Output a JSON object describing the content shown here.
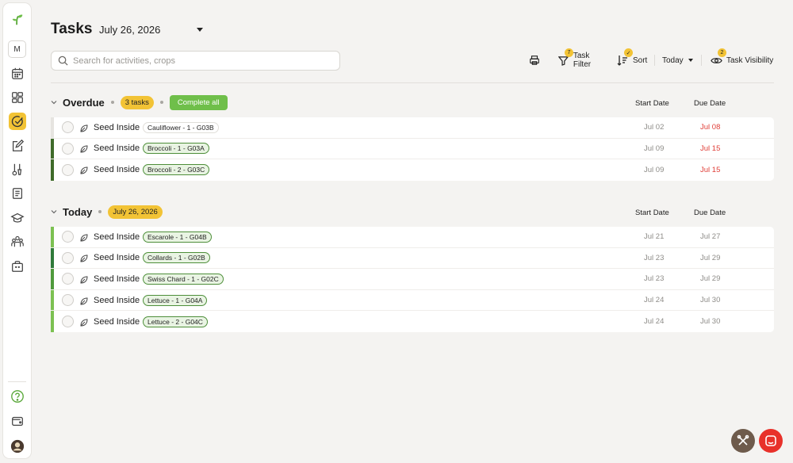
{
  "header": {
    "title": "Tasks",
    "date": "July 26, 2026"
  },
  "search": {
    "placeholder": "Search for activities, crops"
  },
  "toolbar": {
    "print_icon": "printer-icon",
    "task_filter_label": "Task Filter",
    "task_filter_count": "7",
    "sort_label": "Sort",
    "sort_badge": "✓",
    "today_label": "Today",
    "task_visibility_label": "Task Visibility",
    "task_visibility_count": "2"
  },
  "sidebar": {
    "profile_initial": "M",
    "icons": [
      "logo-sprout-icon",
      "calendar-icon",
      "dashboard-icon",
      "tasks-icon",
      "edit-icon",
      "tools-icon",
      "notes-icon",
      "learning-icon",
      "community-icon",
      "store-icon",
      "help-icon",
      "wallet-icon",
      "avatar"
    ]
  },
  "columns": {
    "start": "Start Date",
    "due": "Due Date"
  },
  "overdue": {
    "title": "Overdue",
    "count_label": "3 tasks",
    "complete_all": "Complete all",
    "tasks": [
      {
        "name": "Seed Inside",
        "crop": "Cauliflower - 1 - G03B",
        "start": "Jul 02",
        "due": "Jul 08",
        "bar": "#e6e4e0",
        "tag_style": "plain"
      },
      {
        "name": "Seed Inside",
        "crop": "Broccoli - 1 - G03A",
        "start": "Jul 09",
        "due": "Jul 15",
        "bar": "#3f6b2a",
        "tag_style": "green"
      },
      {
        "name": "Seed Inside",
        "crop": "Broccoli - 2 - G03C",
        "start": "Jul 09",
        "due": "Jul 15",
        "bar": "#3f6b2a",
        "tag_style": "green"
      }
    ]
  },
  "today": {
    "title": "Today",
    "date_label": "July 26, 2026",
    "tasks": [
      {
        "name": "Seed Inside",
        "crop": "Escarole - 1 - G04B",
        "start": "Jul 21",
        "due": "Jul 27",
        "bar": "#7cc152"
      },
      {
        "name": "Seed Inside",
        "crop": "Collards - 1 - G02B",
        "start": "Jul 23",
        "due": "Jul 29",
        "bar": "#2f7a3a"
      },
      {
        "name": "Seed Inside",
        "crop": "Swiss Chard - 1 - G02C",
        "start": "Jul 23",
        "due": "Jul 29",
        "bar": "#4f9a3c"
      },
      {
        "name": "Seed Inside",
        "crop": "Lettuce - 1 - G04A",
        "start": "Jul 24",
        "due": "Jul 30",
        "bar": "#7cc152"
      },
      {
        "name": "Seed Inside",
        "crop": "Lettuce - 2 - G04C",
        "start": "Jul 24",
        "due": "Jul 30",
        "bar": "#7cc152"
      }
    ]
  },
  "colors": {
    "accent_yellow": "#f2c335",
    "accent_green": "#6fbf4a",
    "late_red": "#e0403a",
    "chat_red": "#e8312a",
    "tools_brown": "#6e5b4c"
  },
  "floating": {
    "tools_icon": "tools-icon",
    "chat_icon": "chat-icon"
  }
}
